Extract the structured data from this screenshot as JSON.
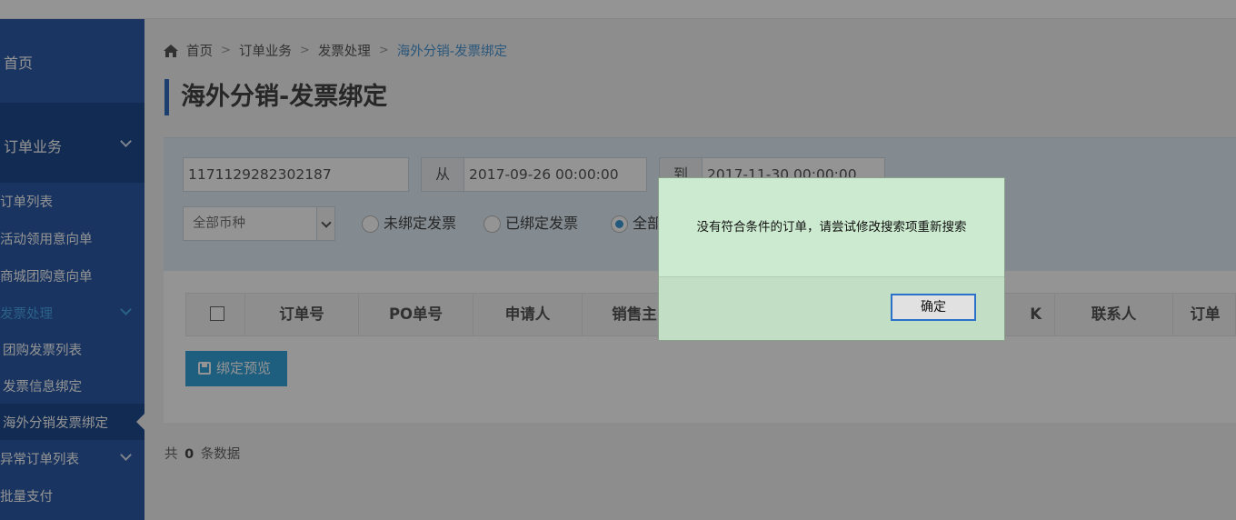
{
  "sidebar": {
    "home": "首页",
    "group_orders": "订单业务",
    "items": {
      "order_list": "订单列表",
      "activity_intent": "活动领用意向单",
      "mall_group_intent": "商城团购意向单",
      "invoice_processing": "发票处理",
      "group_invoice_list": "团购发票列表",
      "invoice_info_bind": "发票信息绑定",
      "overseas_invoice_bind": "海外分销发票绑定",
      "abnormal_orders": "异常订单列表",
      "batch_pay": "批量支付"
    }
  },
  "breadcrumb": {
    "home": "首页",
    "level1": "订单业务",
    "level2": "发票处理",
    "current": "海外分销-发票绑定",
    "separator": ">"
  },
  "page_title": "海外分销-发票绑定",
  "filters": {
    "order_no_value": "1171129282302187",
    "from_label": "从",
    "from_date": "2017-09-26 00:00:00",
    "to_label": "到",
    "to_date": "2017-11-30 00:00:00",
    "currency_selected": "全部币种",
    "radio_unbound": "未绑定发票",
    "radio_bound": "已绑定发票",
    "radio_all": "全部"
  },
  "table": {
    "headers": {
      "order_no": "订单号",
      "po_no": "PO单号",
      "applicant": "申请人",
      "sales_main": "销售主",
      "partial_hidden": "K",
      "contact": "联系人",
      "order_more": "订单"
    }
  },
  "bind_preview_button": "绑定预览",
  "count": {
    "prefix": "共",
    "value": "0",
    "suffix": "条数据"
  },
  "dialog": {
    "message": "没有符合条件的订单，请尝试修改搜索项重新搜索",
    "ok_button": "确定"
  },
  "colors": {
    "sidebar_bg": "#2b5aa6",
    "accent": "#35a3db",
    "dialog_bg": "#cceacf",
    "dialog_button_border": "#2a72c9"
  }
}
